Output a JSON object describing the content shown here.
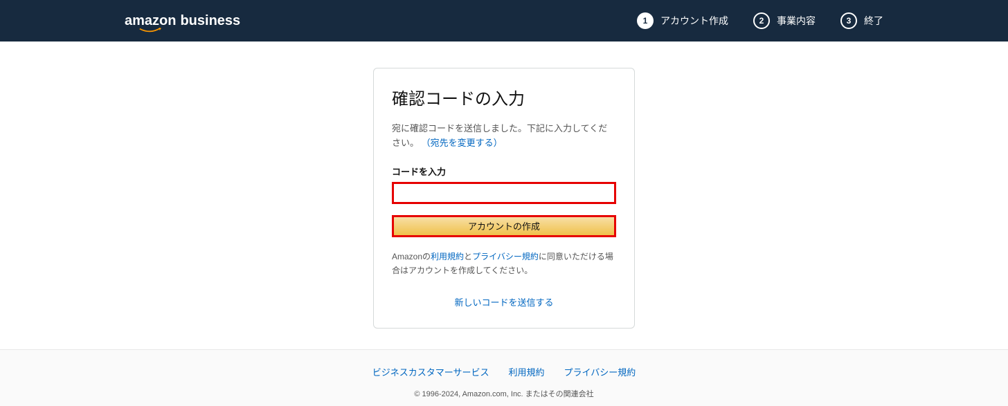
{
  "header": {
    "logo_main": "amazon",
    "logo_sub": "business",
    "steps": [
      {
        "number": "1",
        "label": "アカウント作成",
        "active": true
      },
      {
        "number": "2",
        "label": "事業内容",
        "active": false
      },
      {
        "number": "3",
        "label": "終了",
        "active": false
      }
    ]
  },
  "card": {
    "title": "確認コードの入力",
    "redacted_email": "                              ",
    "instruction_part1": "宛に確認コードを送信しました。下記に入力してください。",
    "change_link": "（宛先を変更する）",
    "field_label": "コードを入力",
    "input_value": "",
    "button_label": "アカウントの作成",
    "terms_prefix": "Amazonの",
    "terms_link": "利用規約",
    "terms_and": "と",
    "privacy_link": "プライバシー規約",
    "terms_suffix": "に同意いただける場合はアカウントを作成してください。",
    "resend_label": "新しいコードを送信する"
  },
  "footer": {
    "links": [
      "ビジネスカスタマーサービス",
      "利用規約",
      "プライバシー規約"
    ],
    "copyright": "© 1996-2024, Amazon.com, Inc. またはその関連会社"
  }
}
